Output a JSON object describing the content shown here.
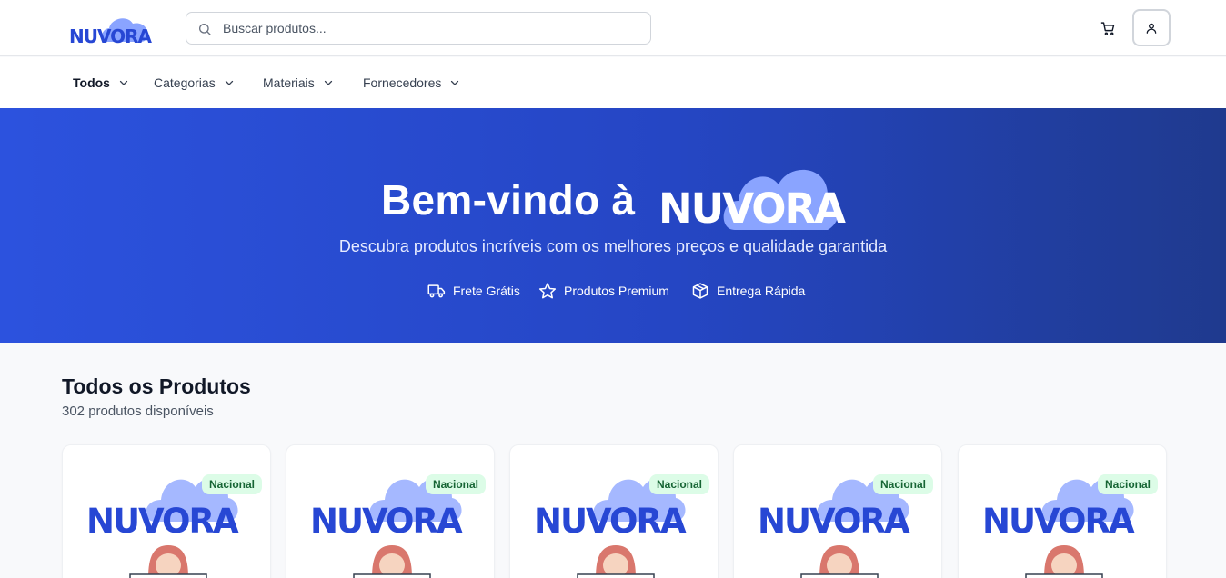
{
  "header": {
    "logo_text": "NUVORA",
    "search": {
      "placeholder": "Buscar produtos...",
      "value": ""
    },
    "icons": {
      "search": "search-icon",
      "cart": "shopping-cart-icon",
      "user": "user-icon"
    }
  },
  "nav": {
    "items": [
      {
        "label": "Todos",
        "active": true
      },
      {
        "label": "Categorias",
        "active": false
      },
      {
        "label": "Materiais",
        "active": false
      },
      {
        "label": "Fornecedores",
        "active": false
      }
    ]
  },
  "hero": {
    "title": "Bem-vindo à",
    "logo_text": "NUVORA",
    "subtitle": "Descubra produtos incríveis com os melhores preços e qualidade garantida",
    "features": [
      {
        "icon": "truck-icon",
        "label": "Frete Grátis"
      },
      {
        "icon": "star-icon",
        "label": "Produtos Premium"
      },
      {
        "icon": "package-icon",
        "label": "Entrega Rápida"
      }
    ]
  },
  "products": {
    "title": "Todos os Produtos",
    "count_text": "302 produtos disponíveis",
    "cards": [
      {
        "badge": "Nacional",
        "image_text": "NUVORA"
      },
      {
        "badge": "Nacional",
        "image_text": "NUVORA"
      },
      {
        "badge": "Nacional",
        "image_text": "NUVORA"
      },
      {
        "badge": "Nacional",
        "image_text": "NUVORA"
      },
      {
        "badge": "Nacional",
        "image_text": "NUVORA"
      }
    ]
  },
  "colors": {
    "brand_blue": "#2c52de",
    "cloud": "#8aa4ff",
    "badge_bg": "#dcfce7",
    "badge_text": "#166534"
  }
}
